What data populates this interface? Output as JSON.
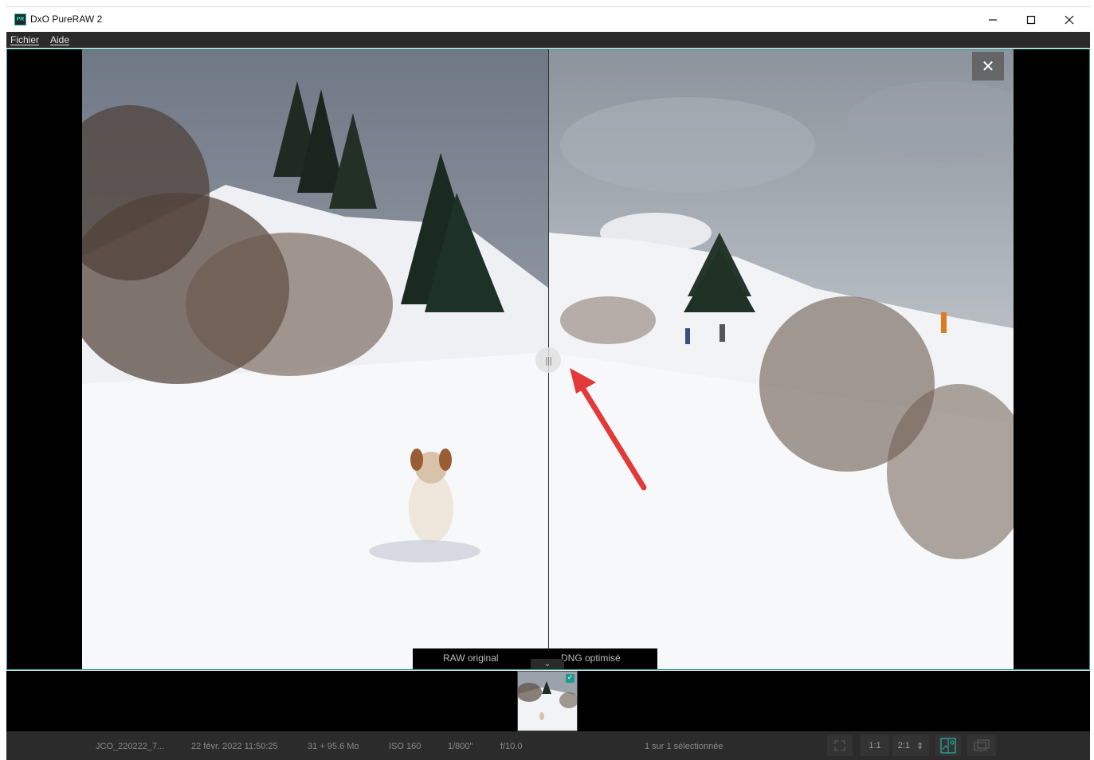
{
  "window": {
    "logo_text": "PR",
    "title": "DxO PureRAW 2",
    "minimize_icon": "minimize-icon",
    "maximize_icon": "maximize-icon",
    "close_icon": "close-icon"
  },
  "menu": {
    "items": [
      {
        "label": "Fichier"
      },
      {
        "label": "Aide"
      }
    ]
  },
  "viewer": {
    "split_handle_glyph": "|||",
    "close_glyph": "✕",
    "label_left": "RAW original",
    "label_right": "DNG optimisé",
    "chevron_glyph": "⌄"
  },
  "filmstrip": {
    "thumbnails": [
      {
        "selected": true,
        "check_glyph": "✓"
      }
    ]
  },
  "status": {
    "filename": "JCO_220222_7...",
    "date": "22 févr. 2022 11:50:25",
    "size": "31 + 95.6 Mo",
    "iso": "ISO 160",
    "shutter": "1/800\"",
    "aperture": "f/10.0",
    "selection": "1 sur 1 sélectionnée",
    "tools": {
      "fit_icon": "fit-screen-icon",
      "zoom_1_1": "1:1",
      "zoom_2_1": "2:1",
      "stepper_glyph": "⇕",
      "compare_icon": "compare-view-icon",
      "single_icon": "single-view-icon"
    }
  },
  "colors": {
    "accent": "#2a9d8f",
    "menubar_bg": "#2a2a2a",
    "statusbar_bg": "#2b2b2b",
    "arrow": "#e23a3a"
  }
}
